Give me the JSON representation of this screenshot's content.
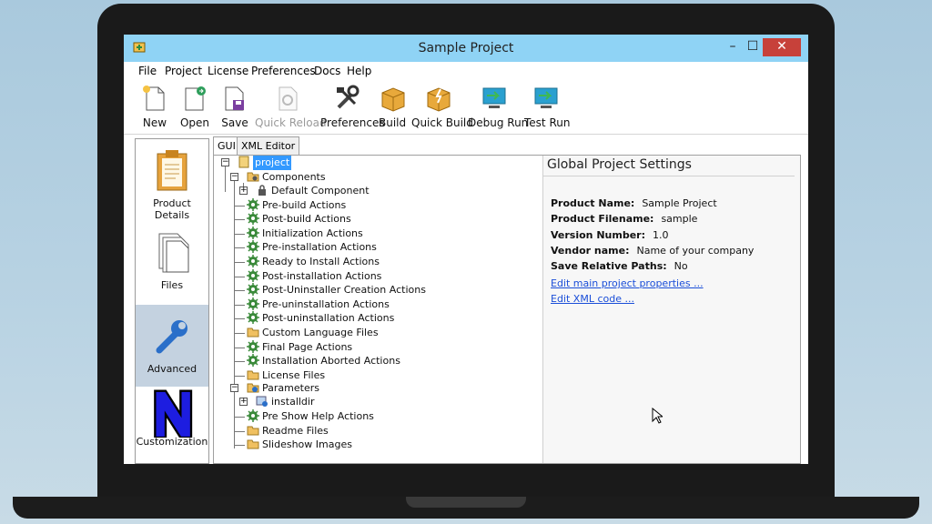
{
  "window": {
    "title": "Sample Project",
    "min": "–",
    "max": "☐",
    "close": "✕"
  },
  "menu": [
    "File",
    "Project",
    "License",
    "Preferences",
    "Docs",
    "Help"
  ],
  "toolbar": [
    {
      "label": "New",
      "icon": "new-file-icon",
      "enabled": true
    },
    {
      "label": "Open",
      "icon": "open-file-icon",
      "enabled": true
    },
    {
      "label": "Save",
      "icon": "save-icon",
      "enabled": true
    },
    {
      "label": "Quick Reload",
      "icon": "reload-icon",
      "enabled": false
    },
    {
      "label": "Preferences",
      "icon": "tools-icon",
      "enabled": true
    },
    {
      "label": "Build",
      "icon": "build-box-icon",
      "enabled": true
    },
    {
      "label": "Quick Build",
      "icon": "quick-build-icon",
      "enabled": true
    },
    {
      "label": "Debug Run",
      "icon": "debug-run-icon",
      "enabled": true
    },
    {
      "label": "Test Run",
      "icon": "test-run-icon",
      "enabled": true
    }
  ],
  "sidebar": [
    {
      "label": "Product Details",
      "icon": "clipboard-icon",
      "active": false
    },
    {
      "label": "Files",
      "icon": "files-icon",
      "active": false
    },
    {
      "label": "Advanced",
      "icon": "wrench-icon",
      "active": true
    },
    {
      "label": "Customization",
      "icon": "customization-n-icon",
      "active": false
    }
  ],
  "tabs": [
    {
      "label": "GUI",
      "active": true
    },
    {
      "label": "XML Editor",
      "active": false
    }
  ],
  "tree": {
    "root": "project",
    "components": "Components",
    "default_component": "Default Component",
    "items": [
      {
        "label": "Pre-build Actions",
        "icon": "gear-icon"
      },
      {
        "label": "Post-build Actions",
        "icon": "gear-icon"
      },
      {
        "label": "Initialization Actions",
        "icon": "gear-icon"
      },
      {
        "label": "Pre-installation Actions",
        "icon": "gear-icon"
      },
      {
        "label": "Ready to Install Actions",
        "icon": "gear-icon"
      },
      {
        "label": "Post-installation Actions",
        "icon": "gear-icon"
      },
      {
        "label": "Post-Uninstaller Creation Actions",
        "icon": "gear-icon"
      },
      {
        "label": "Pre-uninstallation Actions",
        "icon": "gear-icon"
      },
      {
        "label": "Post-uninstallation Actions",
        "icon": "gear-icon"
      },
      {
        "label": "Custom Language Files",
        "icon": "folder-icon"
      },
      {
        "label": "Final Page Actions",
        "icon": "gear-icon"
      },
      {
        "label": "Installation Aborted Actions",
        "icon": "gear-icon"
      },
      {
        "label": "License Files",
        "icon": "folder-icon"
      }
    ],
    "parameters": "Parameters",
    "installdir": "installdir",
    "tail": [
      {
        "label": "Pre Show Help Actions",
        "icon": "gear-icon"
      },
      {
        "label": "Readme Files",
        "icon": "folder-icon"
      },
      {
        "label": "Slideshow Images",
        "icon": "folder-icon"
      }
    ]
  },
  "properties": {
    "title": "Global Project Settings",
    "rows": [
      {
        "key": "Product Name:",
        "value": "Sample Project"
      },
      {
        "key": "Product Filename:",
        "value": "sample"
      },
      {
        "key": "Version Number:",
        "value": "1.0"
      },
      {
        "key": "Vendor name:",
        "value": "Name of your company"
      },
      {
        "key": "Save Relative Paths:",
        "value": "No"
      }
    ],
    "links": [
      "Edit main project properties ...",
      "Edit XML code ..."
    ]
  },
  "colors": {
    "titlebar": "#8fd3f5",
    "selection": "#3399ff",
    "link": "#1a4ed8",
    "active_sidebar": "#c4d2e0",
    "close": "#c7413a"
  }
}
